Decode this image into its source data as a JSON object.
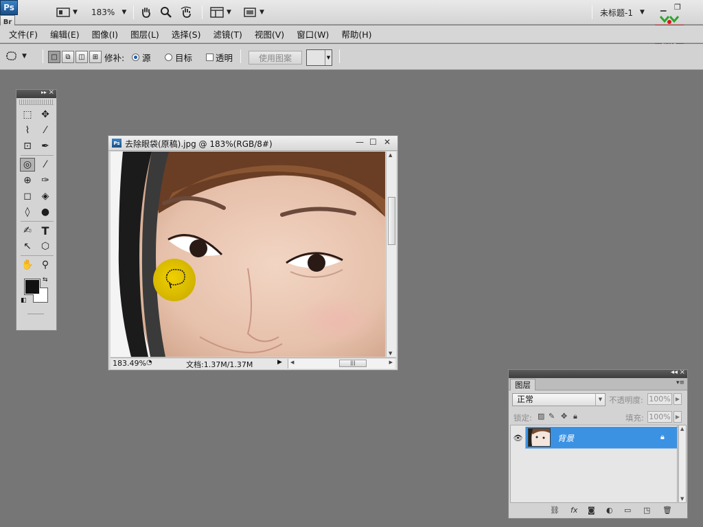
{
  "appbar": {
    "ps_logo": "Ps",
    "br_logo": "Br",
    "zoom": "183%",
    "document_name": "未标题-1",
    "min_glyph": "▁",
    "restore_glyph": "❐"
  },
  "logo": {
    "text_line1": "育碟",
    "text_line2": "教育"
  },
  "menu": [
    "文件(F)",
    "编辑(E)",
    "图像(I)",
    "图层(L)",
    "选择(S)",
    "滤镜(T)",
    "视图(V)",
    "窗口(W)",
    "帮助(H)"
  ],
  "options": {
    "patch_label": "修补:",
    "source_label": "源",
    "dest_label": "目标",
    "transparent_label": "透明",
    "use_pattern": "使用图案"
  },
  "tools": {
    "glyphs": [
      "⬚",
      "✥",
      "⌇",
      "⁄",
      "⊡",
      "✒",
      "◎",
      "⁄",
      "⊕",
      "✑",
      "◻",
      "◈",
      "◊",
      "●",
      "✍",
      "T",
      "↖",
      "⬡",
      "✋",
      "⚲"
    ]
  },
  "document": {
    "title": "去除眼袋(原稿).jpg @ 183%(RGB/8#)",
    "zoom": "183.49%",
    "doc_size": "文档:1.37M/1.37M"
  },
  "layers": {
    "tab": "图层",
    "blend_mode": "正常",
    "opacity_label": "不透明度:",
    "opacity": "100%",
    "lock_label": "锁定:",
    "fill_label": "填充:",
    "fill": "100%",
    "layer_name": "背景"
  },
  "colors": {
    "accent": "#3b92e3",
    "workspace": "#767676",
    "highlight": "#e2c600"
  }
}
